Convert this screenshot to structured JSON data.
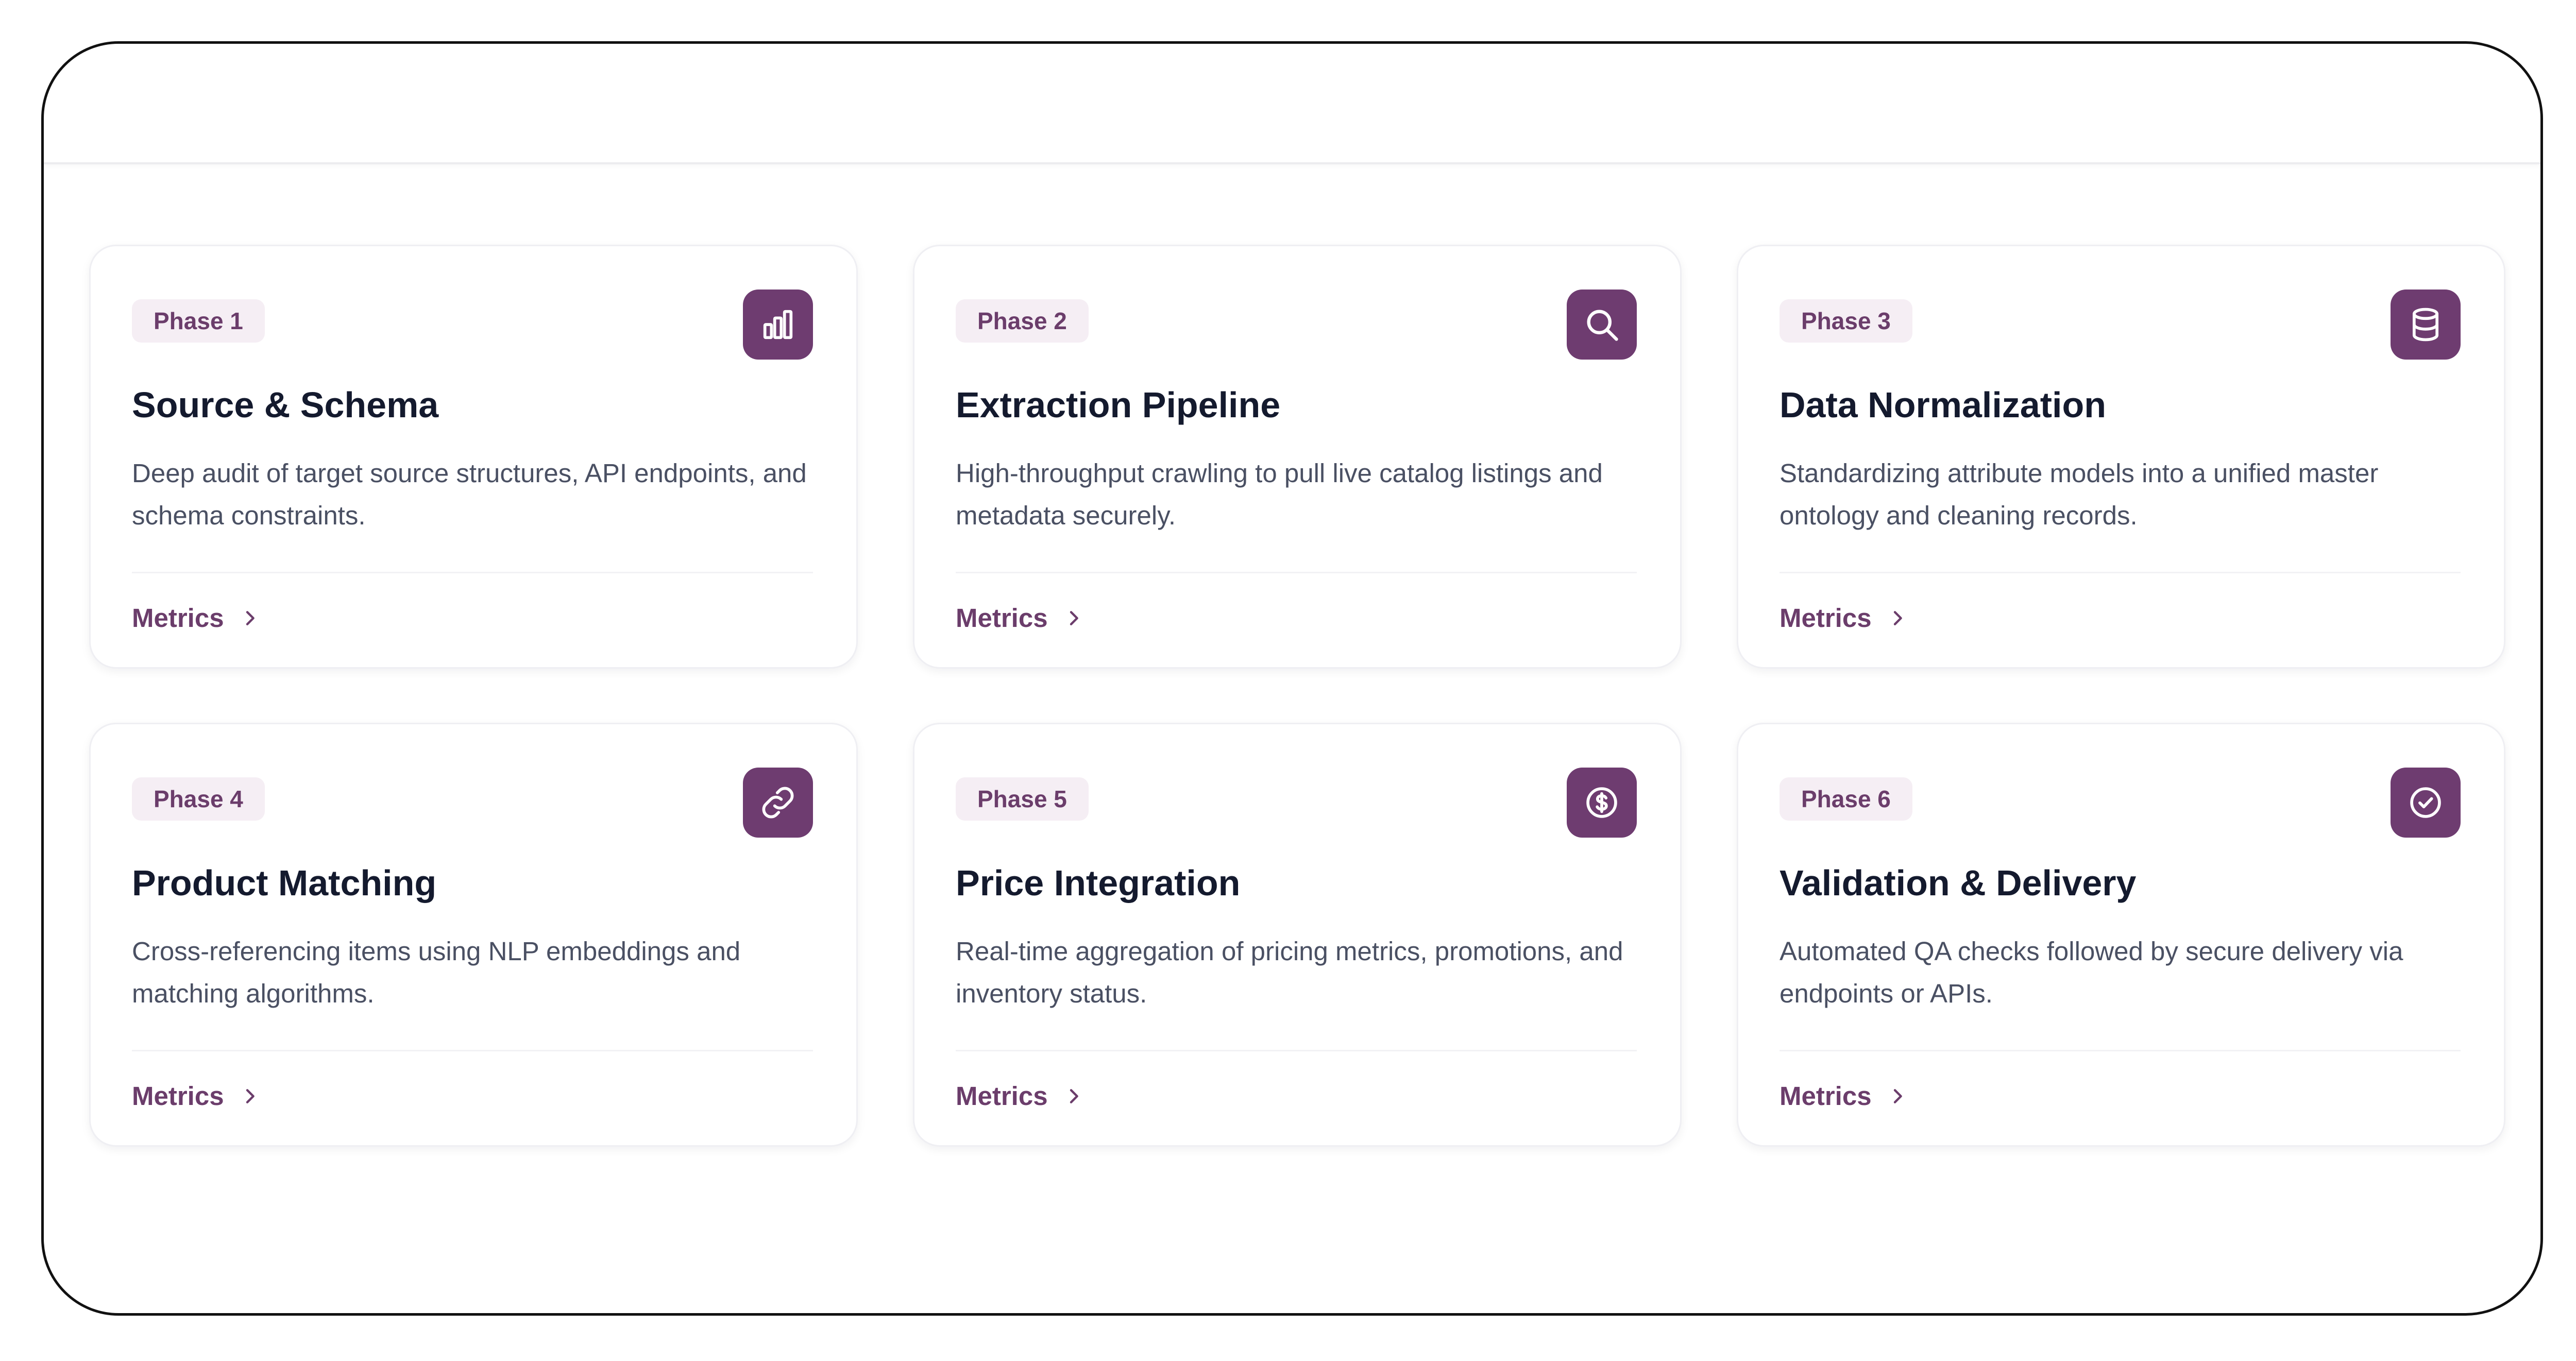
{
  "cards": [
    {
      "phase": "Phase 1",
      "icon": "bar-chart-icon",
      "title": "Source & Schema",
      "description": "Deep audit of target source structures, API endpoints, and schema constraints.",
      "link": "Metrics"
    },
    {
      "phase": "Phase 2",
      "icon": "search-icon",
      "title": "Extraction Pipeline",
      "description": "High-throughput crawling to pull live catalog listings and metadata securely.",
      "link": "Metrics"
    },
    {
      "phase": "Phase 3",
      "icon": "database-icon",
      "title": "Data Normalization",
      "description": "Standardizing attribute models into a unified master ontology and cleaning records.",
      "link": "Metrics"
    },
    {
      "phase": "Phase 4",
      "icon": "link-icon",
      "title": "Product Matching",
      "description": "Cross-referencing items using NLP embeddings and matching algorithms.",
      "link": "Metrics"
    },
    {
      "phase": "Phase 5",
      "icon": "dollar-circle-icon",
      "title": "Price Integration",
      "description": "Real-time aggregation of pricing metrics, promotions, and inventory status.",
      "link": "Metrics"
    },
    {
      "phase": "Phase 6",
      "icon": "check-circle-icon",
      "title": "Validation & Delivery",
      "description": "Automated QA checks followed by secure delivery via endpoints or APIs.",
      "link": "Metrics"
    }
  ],
  "colors": {
    "accent": "#6e3c70",
    "badge_bg": "#f5eef4",
    "badge_text": "#6b3d6b",
    "title_text": "#141a2e",
    "body_text": "#4a5063"
  }
}
